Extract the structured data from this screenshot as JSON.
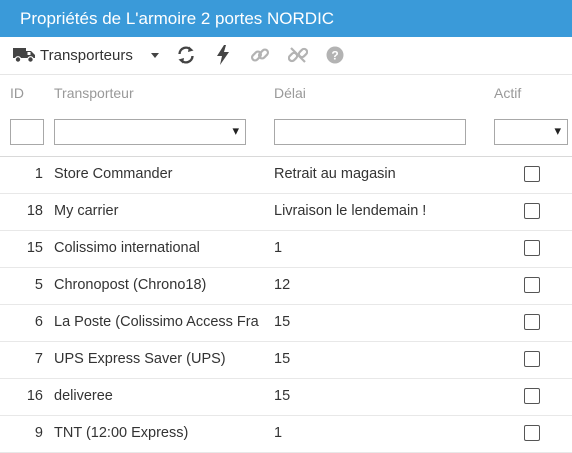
{
  "window": {
    "title": "Propriétés de L'armoire 2 portes NORDIC"
  },
  "toolbar": {
    "carriers_label": "Transporteurs",
    "icons": [
      "truck-icon",
      "caret-down-icon",
      "refresh-icon",
      "bolt-icon",
      "link-icon",
      "unlink-icon",
      "help-icon"
    ]
  },
  "grid": {
    "columns": {
      "id": "ID",
      "carrier": "Transporteur",
      "delay": "Délai",
      "active": "Actif"
    },
    "rows": [
      {
        "id": "1",
        "carrier": "Store Commander",
        "delay": "Retrait au magasin",
        "active": false
      },
      {
        "id": "18",
        "carrier": "My carrier",
        "delay": "Livraison le lendemain !",
        "active": false
      },
      {
        "id": "15",
        "carrier": "Colissimo international",
        "delay": "1",
        "active": false
      },
      {
        "id": "5",
        "carrier": "Chronopost (Chrono18)",
        "delay": "12",
        "active": false
      },
      {
        "id": "6",
        "carrier": "La Poste (Colissimo Access Fra",
        "delay": "15",
        "active": false
      },
      {
        "id": "7",
        "carrier": "UPS Express Saver (UPS)",
        "delay": "15",
        "active": false
      },
      {
        "id": "16",
        "carrier": "deliveree",
        "delay": "15",
        "active": false
      },
      {
        "id": "9",
        "carrier": "TNT (12:00 Express)",
        "delay": "1",
        "active": false
      }
    ]
  },
  "colors": {
    "titlebar": "#3a9ad9",
    "icon_dark": "#444444",
    "icon_disabled": "#b3b3b3",
    "header_text": "#999999"
  }
}
